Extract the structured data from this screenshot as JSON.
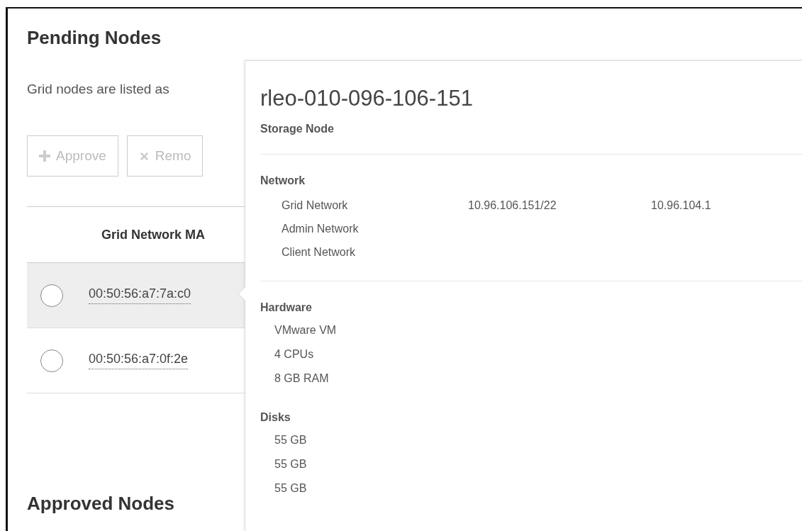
{
  "pending": {
    "title": "Pending Nodes",
    "description": "Grid nodes are listed as",
    "buttons": [
      {
        "kind": "approve",
        "label": "Approve",
        "disabled": true
      },
      {
        "kind": "remove",
        "label": "Remo",
        "disabled": true
      }
    ],
    "table": {
      "columns": [
        "Grid Network MA"
      ],
      "rows": [
        {
          "mac": "00:50:56:a7:7a:c0",
          "selected": false,
          "hovered": true
        },
        {
          "mac": "00:50:56:a7:0f:2e",
          "selected": false,
          "hovered": false
        }
      ]
    }
  },
  "approved": {
    "title": "Approved Nodes"
  },
  "popover": {
    "title": "rleo-010-096-106-151",
    "subtitle": "Storage Node",
    "network": {
      "heading": "Network",
      "rows": [
        {
          "name": "Grid Network",
          "address": "10.96.106.151/22",
          "gateway": "10.96.104.1"
        },
        {
          "name": "Admin Network"
        },
        {
          "name": "Client Network"
        }
      ]
    },
    "hardware": {
      "heading": "Hardware",
      "items": [
        "VMware VM",
        "4 CPUs",
        "8 GB RAM"
      ]
    },
    "disks": {
      "heading": "Disks",
      "items": [
        "55 GB",
        "55 GB",
        "55 GB"
      ]
    }
  }
}
